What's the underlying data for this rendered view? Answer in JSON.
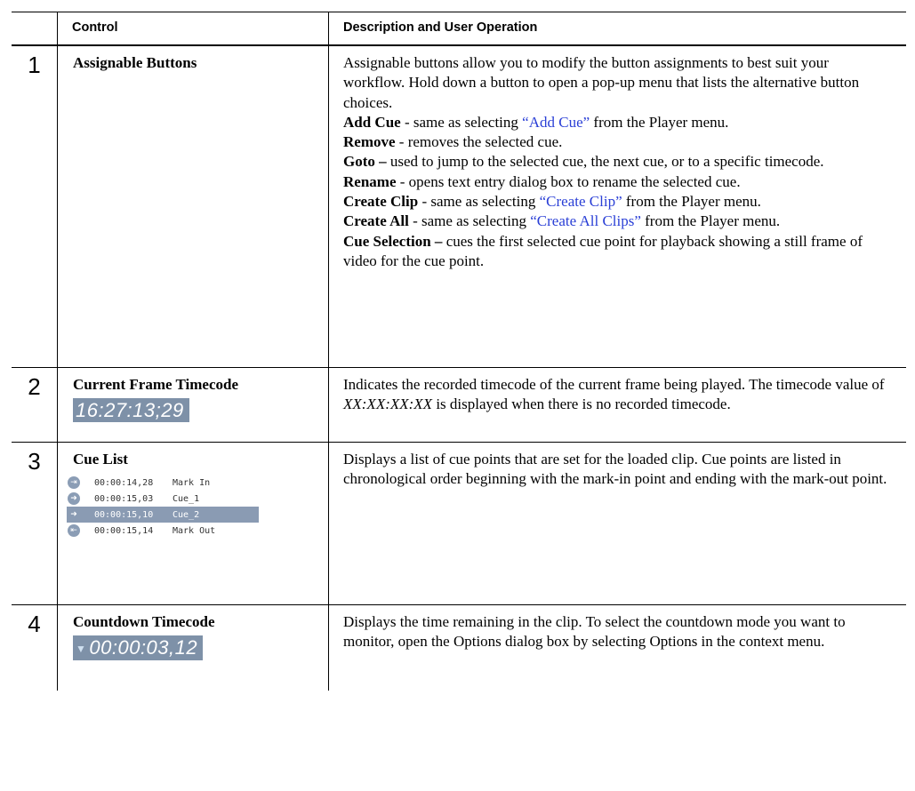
{
  "header": {
    "control": "Control",
    "description": "Description and User Operation"
  },
  "rows": [
    {
      "num": "1",
      "title": "Assignable Buttons",
      "intro": "Assignable buttons allow you to modify the button assignments to best suit your workflow. Hold down a button to open a pop-up menu that lists the alternative button choices.",
      "items": [
        {
          "term": "Add Cue",
          "pre": " - same as selecting ",
          "link": "“Add Cue”",
          "post": " from the Player menu."
        },
        {
          "term": "Remove",
          "pre": " - removes the selected cue.",
          "link": "",
          "post": ""
        },
        {
          "term": "Goto –",
          "pre": " used to jump to the selected cue, the next cue, or to a specific timecode.",
          "link": "",
          "post": ""
        },
        {
          "term": "Rename",
          "pre": " - opens text entry dialog box to rename the selected cue.",
          "link": "",
          "post": ""
        },
        {
          "term": "Create Clip",
          "pre": " - same as selecting ",
          "link": "“Create Clip”",
          "post": " from the Player menu."
        },
        {
          "term": "Create All",
          "pre": " - same as selecting ",
          "link": "“Create All Clips”",
          "post": " from the Player menu."
        },
        {
          "term": "Cue Selection –",
          "pre": " cues the first selected cue point for playback showing a still frame of video for the cue point.",
          "link": "",
          "post": ""
        }
      ]
    },
    {
      "num": "2",
      "title": "Current Frame Timecode",
      "timecode": "16:27:13;29",
      "desc_a": "Indicates the recorded timecode of the current frame being played. The timecode value of ",
      "desc_em": "XX:XX:XX:XX",
      "desc_b": " is displayed when there is no recorded timecode."
    },
    {
      "num": "3",
      "title": "Cue List",
      "cues": [
        {
          "icon": "mark-in-icon",
          "glyph": "⇥",
          "time": "00:00:14,28",
          "name": "Mark In",
          "selected": false
        },
        {
          "icon": "cue-arrow-icon",
          "glyph": "➜",
          "time": "00:00:15,03",
          "name": "Cue_1",
          "selected": false
        },
        {
          "icon": "cue-arrow-icon",
          "glyph": "➜",
          "time": "00:00:15,10",
          "name": "Cue_2",
          "selected": true
        },
        {
          "icon": "mark-out-icon",
          "glyph": "⇤",
          "time": "00:00:15,14",
          "name": "Mark Out",
          "selected": false
        }
      ],
      "desc": "Displays a list of cue points that are set for the loaded clip. Cue points are listed in chronological order beginning with the mark-in point and ending with the mark-out point."
    },
    {
      "num": "4",
      "title": "Countdown Timecode",
      "timecode": "00:00:03,12",
      "desc": "Displays the time remaining in the clip. To select the countdown mode you want to monitor, open the Options dialog box by selecting Options in the context menu."
    }
  ]
}
